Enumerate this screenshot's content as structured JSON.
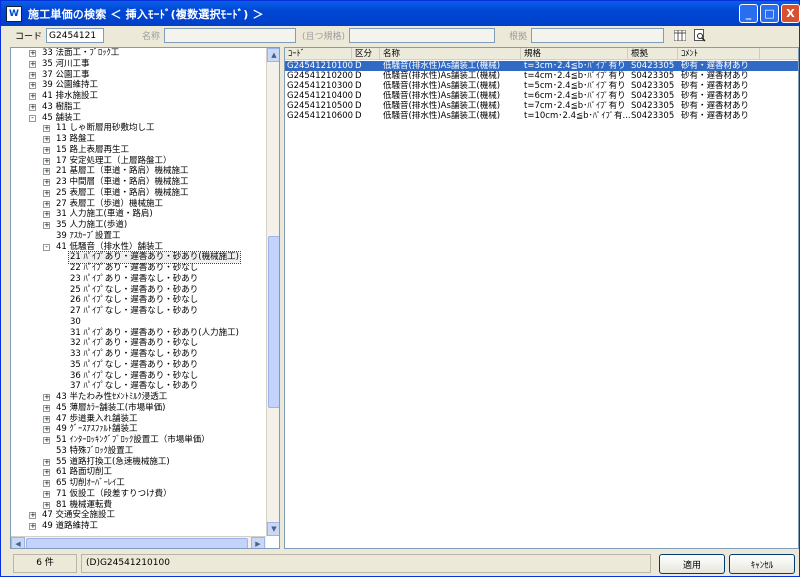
{
  "window": {
    "app_icon_text": "W",
    "title": "施工単価の検索 ＜ 挿入ﾓｰﾄﾞ(複数選択ﾓｰﾄﾞ) ＞",
    "min_glyph": "_",
    "max_glyph": "□",
    "close_glyph": "X"
  },
  "search": {
    "code_label": "コード",
    "code_value": "G2454121",
    "name_label": "名称",
    "name_value": "",
    "spec_label": "(且つ規格)",
    "spec_value": "",
    "basis_label": "根拠",
    "basis_value": ""
  },
  "tree": {
    "items": [
      {
        "label": "33 法面工・ﾌﾞﾛｯｸ工",
        "exp": "+"
      },
      {
        "label": "35 河川工事",
        "exp": "+"
      },
      {
        "label": "37 公園工事",
        "exp": "+"
      },
      {
        "label": "39 公園維持工",
        "exp": "+"
      },
      {
        "label": "41 排水施設工",
        "exp": "+"
      },
      {
        "label": "43 樹脂工",
        "exp": "+"
      },
      {
        "label": "45 舗装工",
        "exp": "-"
      },
      {
        "label": "11 しゃ断層用砂敷均し工",
        "exp": "+"
      },
      {
        "label": "13 路盤工",
        "exp": "+"
      },
      {
        "label": "15 路上表層再生工",
        "exp": "+"
      },
      {
        "label": "17 安定処理工（上層路盤工）",
        "exp": "+"
      },
      {
        "label": "21 基層工（車道・路肩）機械施工",
        "exp": "+"
      },
      {
        "label": "23 中間層（車道・路肩）機械施工",
        "exp": "+"
      },
      {
        "label": "25 表層工（車道・路肩）機械施工",
        "exp": "+"
      },
      {
        "label": "27 表層工（歩道）機械施工",
        "exp": "+"
      },
      {
        "label": "31 人力施工(車道・路肩)",
        "exp": "+"
      },
      {
        "label": "35 人力施工(歩道)",
        "exp": "+"
      },
      {
        "label": "39 ｱｽｶｰﾌﾞ設置工",
        "exp": ""
      },
      {
        "label": "41 低騒音（排水性）舗装工",
        "exp": "-"
      },
      {
        "label": "21 ﾊﾟｲﾌﾟあり・遅香あり・砂あり(機械施工)",
        "exp": "",
        "sel": true
      },
      {
        "label": "22 ﾊﾟｲﾌﾟあり・遅香あり・砂なし",
        "exp": ""
      },
      {
        "label": "23 ﾊﾟｲﾌﾟあり・遅香なし・砂あり",
        "exp": ""
      },
      {
        "label": "25 ﾊﾟｲﾌﾟなし・遅香あり・砂あり",
        "exp": ""
      },
      {
        "label": "26 ﾊﾟｲﾌﾟなし・遅香あり・砂なし",
        "exp": ""
      },
      {
        "label": "27 ﾊﾟｲﾌﾟなし・遅香なし・砂あり",
        "exp": ""
      },
      {
        "label": "30",
        "exp": ""
      },
      {
        "label": "31 ﾊﾟｲﾌﾟあり・遅香あり・砂あり(人力施工)",
        "exp": ""
      },
      {
        "label": "32 ﾊﾟｲﾌﾟあり・遅香あり・砂なし",
        "exp": ""
      },
      {
        "label": "33 ﾊﾟｲﾌﾟあり・遅香なし・砂あり",
        "exp": ""
      },
      {
        "label": "35 ﾊﾟｲﾌﾟなし・遅香あり・砂あり",
        "exp": ""
      },
      {
        "label": "36 ﾊﾟｲﾌﾟなし・遅香あり・砂なし",
        "exp": ""
      },
      {
        "label": "37 ﾊﾟｲﾌﾟなし・遅香なし・砂あり",
        "exp": ""
      },
      {
        "label": "43 半たわみ性ｾﾒﾝﾄﾐﾙｸ浸透工",
        "exp": "+"
      },
      {
        "label": "45 薄層ｶﾗｰ舗装工(市場単価)",
        "exp": "+"
      },
      {
        "label": "47 歩道乗入れ舗装工",
        "exp": "+"
      },
      {
        "label": "49 ｸﾞｰｽｱｽﾌｧﾙﾄ舗装工",
        "exp": "+"
      },
      {
        "label": "51 ｲﾝﾀｰﾛｯｷﾝｸﾞﾌﾞﾛｯｸ設置工（市場単価）",
        "exp": "+"
      },
      {
        "label": "53 特殊ﾌﾞﾛｯｸ設置工",
        "exp": ""
      },
      {
        "label": "55 道路打換工(急速機械施工)",
        "exp": "+"
      },
      {
        "label": "61 路面切削工",
        "exp": "+"
      },
      {
        "label": "65 切削ｵｰﾊﾞｰﾚｲ工",
        "exp": "+"
      },
      {
        "label": "71 仮設工（段差すりつけ費）",
        "exp": "+"
      },
      {
        "label": "81 機械運転費",
        "exp": "+"
      },
      {
        "label": "47 交通安全施設工",
        "exp": "+"
      },
      {
        "label": "49 道路維持工",
        "exp": "+"
      }
    ]
  },
  "list": {
    "headers": [
      "ｺｰﾄﾞ",
      "区分",
      "名称",
      "規格",
      "根拠",
      "ｺﾒﾝﾄ"
    ],
    "rows": [
      [
        "G24541210100",
        "D",
        "低騒音(排水性)As舗装工(機械)",
        "t=3cm･2.4≦b･ﾊﾟｲﾌﾟ有り",
        "S0423305",
        "砂有・遅香材あり"
      ],
      [
        "G24541210200",
        "D",
        "低騒音(排水性)As舗装工(機械)",
        "t=4cm･2.4≦b･ﾊﾟｲﾌﾟ有り",
        "S0423305",
        "砂有・遅香材あり"
      ],
      [
        "G24541210300",
        "D",
        "低騒音(排水性)As舗装工(機械)",
        "t=5cm･2.4≦b･ﾊﾟｲﾌﾟ有り",
        "S0423305",
        "砂有・遅香材あり"
      ],
      [
        "G24541210400",
        "D",
        "低騒音(排水性)As舗装工(機械)",
        "t=6cm･2.4≦b･ﾊﾟｲﾌﾟ有り",
        "S0423305",
        "砂有・遅香材あり"
      ],
      [
        "G24541210500",
        "D",
        "低騒音(排水性)As舗装工(機械)",
        "t=7cm･2.4≦b･ﾊﾟｲﾌﾟ有り",
        "S0423305",
        "砂有・遅香材あり"
      ],
      [
        "G24541210600",
        "D",
        "低騒音(排水性)As舗装工(機械)",
        "t=10cm･2.4≦b･ﾊﾟｲﾌﾟ有...",
        "S0423305",
        "砂有・遅香材あり"
      ]
    ]
  },
  "status": {
    "count": "6 件",
    "selected": "(D)G24541210100",
    "apply_label": "適用",
    "cancel_label": "ｷｬﾝｾﾙ"
  },
  "colors": {
    "title_bar": "#0046d5",
    "selection": "#316ac5",
    "close_button": "#d8502f"
  }
}
